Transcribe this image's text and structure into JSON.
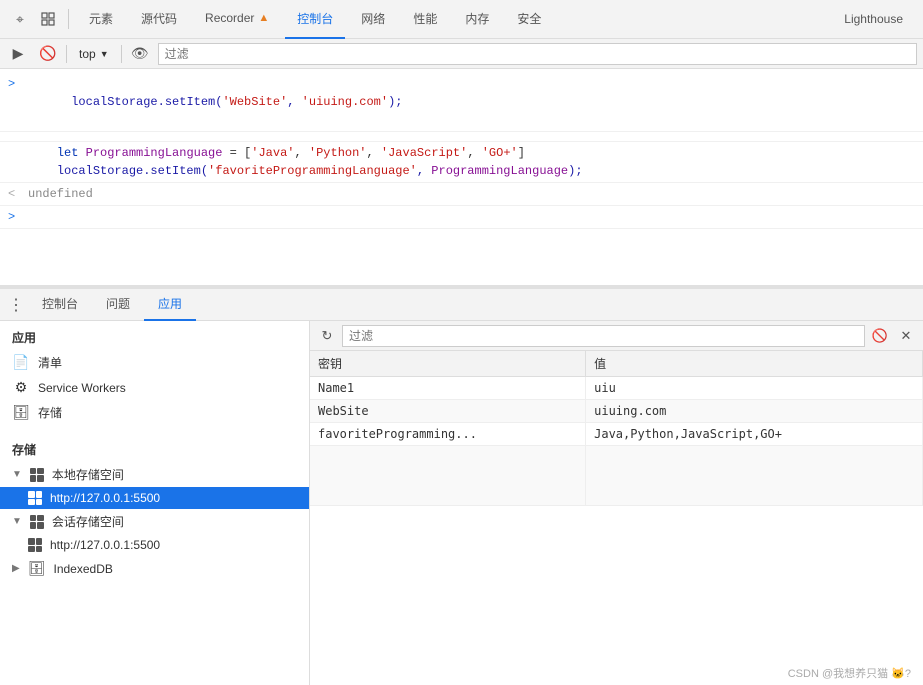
{
  "topNav": {
    "tabs": [
      "元素",
      "源代码",
      "Recorder",
      "控制台",
      "网络",
      "性能",
      "内存",
      "安全",
      "Lighthouse"
    ],
    "activeTab": "控制台",
    "recorderHasIndicator": true
  },
  "consoleToolbar": {
    "topLabel": "top",
    "filterPlaceholder": "过滤"
  },
  "consoleOutput": {
    "lines": [
      {
        "prefix": ">",
        "prefixType": "arrow-right",
        "segments": [
          {
            "text": "localStorage.setItem(",
            "class": "code-blue"
          },
          {
            "text": "'WebSite'",
            "class": "code-string"
          },
          {
            "text": ", ",
            "class": "code-blue"
          },
          {
            "text": "'uiuing.com'",
            "class": "code-string"
          },
          {
            "text": ");",
            "class": "code-blue"
          }
        ]
      },
      {
        "prefix": "",
        "prefixType": "",
        "segments": []
      },
      {
        "prefix": "",
        "prefixType": "",
        "multiline": true,
        "text": "    let ProgrammingLanguage = ['Java', 'Python', 'JavaScript', 'GO+']\n    localStorage.setItem('favoriteProgrammingLanguage', ProgrammingLanguage);"
      },
      {
        "prefix": "<",
        "prefixType": "arrow-left",
        "segments": [
          {
            "text": "undefined",
            "class": "code-undefined"
          }
        ]
      },
      {
        "prefix": ">",
        "prefixType": "arrow-right",
        "segments": []
      }
    ]
  },
  "bottomTabs": {
    "tabs": [
      "控制台",
      "问题",
      "应用"
    ],
    "activeTab": "应用"
  },
  "sidebar": {
    "appSectionTitle": "应用",
    "appItems": [
      {
        "icon": "📄",
        "label": "清单",
        "iconType": "doc"
      },
      {
        "icon": "⚙",
        "label": "Service Workers",
        "iconType": "gear"
      },
      {
        "icon": "🗄",
        "label": "存储",
        "iconType": "db"
      }
    ],
    "storageSectionTitle": "存储",
    "storageTree": [
      {
        "label": "本地存储空间",
        "level": 0,
        "expanded": true,
        "hasGrid": true,
        "selected": false
      },
      {
        "label": "http://127.0.0.1:5500",
        "level": 1,
        "expanded": false,
        "hasGrid": true,
        "selected": true
      },
      {
        "label": "会话存储空间",
        "level": 0,
        "expanded": true,
        "hasGrid": true,
        "selected": false
      },
      {
        "label": "http://127.0.0.1:5500",
        "level": 1,
        "expanded": false,
        "hasGrid": true,
        "selected": false
      },
      {
        "label": "IndexedDB",
        "level": 0,
        "expanded": false,
        "hasGrid": false,
        "selected": false,
        "dbIcon": true
      }
    ]
  },
  "storagePanel": {
    "filterPlaceholder": "过滤",
    "columns": [
      "密钥",
      "值"
    ],
    "rows": [
      {
        "key": "Name1",
        "value": "uiu"
      },
      {
        "key": "WebSite",
        "value": "uiuing.com"
      },
      {
        "key": "favoriteProgramming...",
        "value": "Java,Python,JavaScript,GO+"
      }
    ]
  },
  "attribution": "CSDN @我想养只猫  🐱?"
}
